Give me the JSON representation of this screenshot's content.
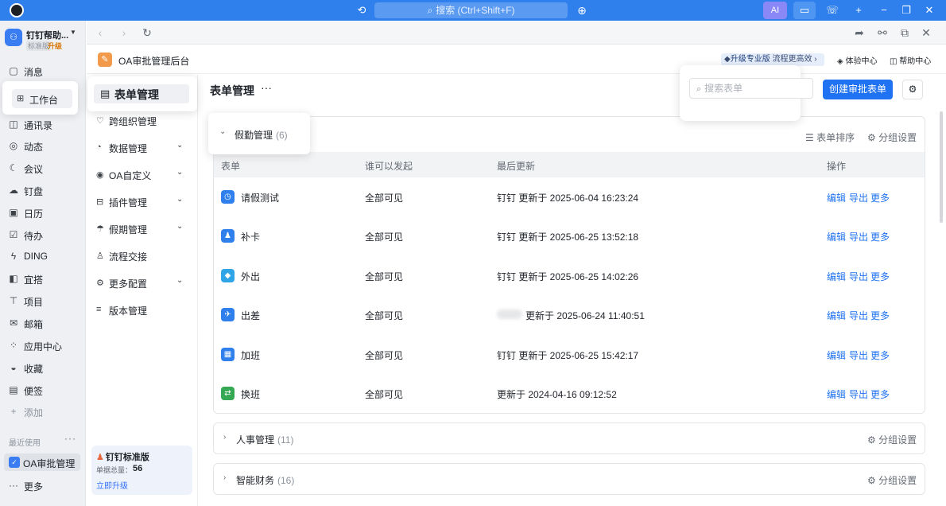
{
  "titlebar": {
    "search_placeholder": "搜索 (Ctrl+Shift+F)",
    "ai_label": "AI"
  },
  "org": {
    "name": "钉钉帮助...",
    "edition": "标准版",
    "upgrade": "升级"
  },
  "appnav": [
    {
      "label": "消息",
      "icon": "message-icon"
    },
    {
      "label": "工作台",
      "icon": "workbench-icon"
    },
    {
      "label": "通讯录",
      "icon": "contacts-icon"
    },
    {
      "label": "动态",
      "icon": "activity-icon"
    },
    {
      "label": "会议",
      "icon": "meeting-icon"
    },
    {
      "label": "钉盘",
      "icon": "drive-icon"
    },
    {
      "label": "日历",
      "icon": "calendar-icon"
    },
    {
      "label": "待办",
      "icon": "todo-icon"
    },
    {
      "label": "DING",
      "icon": "ding-icon"
    },
    {
      "label": "宜搭",
      "icon": "yida-icon"
    },
    {
      "label": "项目",
      "icon": "project-icon"
    },
    {
      "label": "邮箱",
      "icon": "mail-icon"
    },
    {
      "label": "应用中心",
      "icon": "app-center-icon"
    },
    {
      "label": "收藏",
      "icon": "favorites-icon"
    },
    {
      "label": "便签",
      "icon": "notes-icon"
    },
    {
      "label": "添加",
      "icon": "plus-icon"
    }
  ],
  "recent": {
    "title": "最近使用",
    "app_label": "OA审批管理",
    "more_label": "更多"
  },
  "page": {
    "app_title": "OA审批管理后台",
    "promo_strong": "升级专业版",
    "promo_text": "流程更高效",
    "experience_center": "体验中心",
    "help_center": "帮助中心"
  },
  "sidenav": {
    "active": "表单管理",
    "items": [
      {
        "label": "跨组织管理",
        "icon": "cross-org-icon",
        "chevron": false
      },
      {
        "label": "数据管理",
        "icon": "data-icon",
        "chevron": true
      },
      {
        "label": "OA自定义",
        "icon": "custom-icon",
        "chevron": true
      },
      {
        "label": "插件管理",
        "icon": "plugin-icon",
        "chevron": true
      },
      {
        "label": "假期管理",
        "icon": "holiday-icon",
        "chevron": true
      },
      {
        "label": "流程交接",
        "icon": "handover-icon",
        "chevron": false
      },
      {
        "label": "更多配置",
        "icon": "settings-icon",
        "chevron": true
      },
      {
        "label": "版本管理",
        "icon": "version-icon",
        "chevron": false
      }
    ]
  },
  "edition_card": {
    "name": "钉钉标准版",
    "count_label": "单据总量：",
    "count_value": "56",
    "upgrade_link": "立即升级"
  },
  "main": {
    "title": "表单管理",
    "dots": "···",
    "search_placeholder": "搜索表单",
    "create_button": "创建审批表单"
  },
  "group": {
    "name": "假勤管理",
    "count": "(6)",
    "sort_label": "表单排序",
    "settings_label": "分组设置",
    "columns": [
      "表单",
      "谁可以发起",
      "最后更新",
      "操作"
    ],
    "rows": [
      {
        "name": "请假测试",
        "who": "全部可见",
        "updated": "钉钉 更新于 2025-06-04 16:23:24",
        "icon": "clock-icon",
        "color": "#2f80ed"
      },
      {
        "name": "补卡",
        "who": "全部可见",
        "updated": "钉钉 更新于 2025-06-25 13:52:18",
        "icon": "person-icon",
        "color": "#2f80ed"
      },
      {
        "name": "外出",
        "who": "全部可见",
        "updated": "钉钉 更新于 2025-06-25 14:02:26",
        "icon": "diamond-icon",
        "color": "#2fa4e7"
      },
      {
        "name": "出差",
        "who": "全部可见",
        "updated": "更新于 2025-06-24 11:40:51",
        "icon": "plane-icon",
        "color": "#2f80ed"
      },
      {
        "name": "加班",
        "who": "全部可见",
        "updated": "钉钉 更新于 2025-06-25 15:42:17",
        "icon": "building-icon",
        "color": "#2f80ed"
      },
      {
        "name": "换班",
        "who": "全部可见",
        "updated": "更新于 2024-04-16 09:12:52",
        "icon": "swap-icon",
        "color": "#34a853"
      }
    ],
    "actions": [
      "编辑",
      "导出",
      "更多"
    ]
  },
  "collapsed_groups": [
    {
      "name": "人事管理",
      "count": "(11)",
      "settings_label": "分组设置"
    },
    {
      "name": "智能财务",
      "count": "(16)",
      "settings_label": "分组设置"
    }
  ]
}
